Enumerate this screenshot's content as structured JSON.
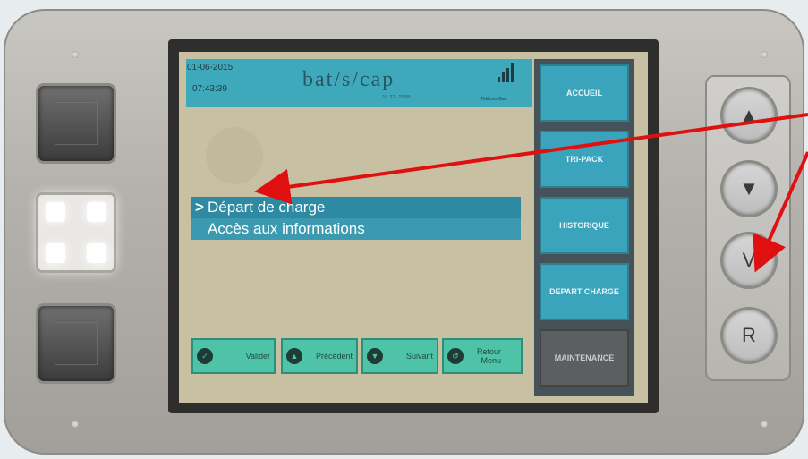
{
  "screen": {
    "date": "01-06-2015",
    "time": "07:43:39",
    "logo": "bat/s/cap",
    "version": "V1.32 - 15/08",
    "operator": "Télécom Bat",
    "menu": {
      "cursor": ">",
      "items": [
        "Départ de charge",
        "Accès aux informations"
      ]
    },
    "side_buttons": [
      "ACCUEIL",
      "TRI-PACK",
      "HISTORIQUE",
      "DEPART CHARGE",
      "MAINTENANCE"
    ],
    "bottom_buttons": [
      {
        "icon": "check-icon",
        "label": "Valider"
      },
      {
        "icon": "up-icon",
        "label": "Précédent"
      },
      {
        "icon": "down-icon",
        "label": "Suivant"
      },
      {
        "icon": "return-icon",
        "label": "Retour Menu"
      }
    ]
  },
  "hardware_buttons": {
    "up": "▲",
    "down": "▼",
    "validate": "V",
    "reset": "R"
  },
  "colors": {
    "topbar": "#3fa9bc",
    "menu": "#3c9ab0",
    "side_button": "#3aa4bd",
    "bottom_button": "#4fc3a8",
    "annotation_arrow": "#e01010"
  }
}
